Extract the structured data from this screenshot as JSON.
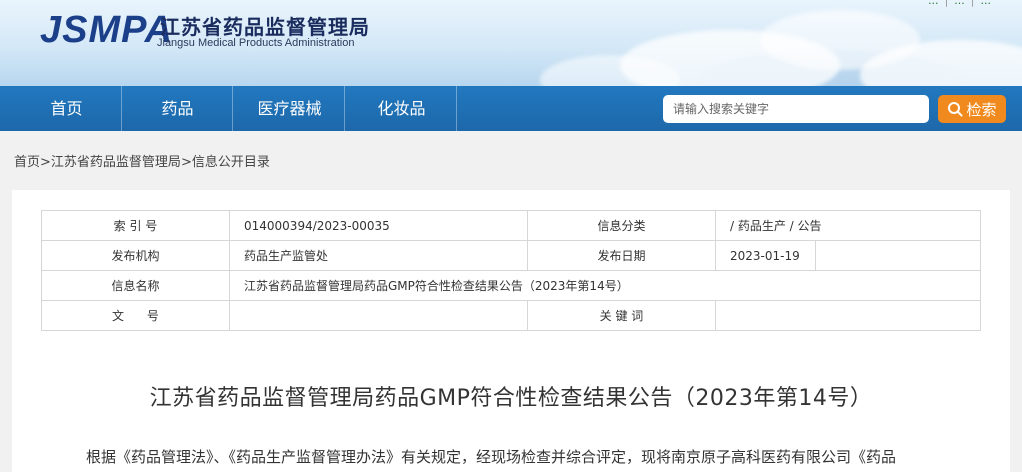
{
  "header": {
    "logo_abbr": "JSMPA",
    "logo_cn": "江苏省药品监督管理局",
    "logo_en": "Jiangsu Medical Products Administration",
    "top_links": [
      "...",
      "...",
      "..."
    ]
  },
  "nav": {
    "items": [
      "首页",
      "药品",
      "医疗器械",
      "化妆品"
    ],
    "search_placeholder": "请输入搜索关键字",
    "search_button": "检索"
  },
  "breadcrumb": {
    "items": [
      "首页",
      "江苏省药品监督管理局",
      "信息公开目录"
    ],
    "separator": ">"
  },
  "info_table": {
    "index_label": "索 引 号",
    "index_value": "014000394/2023-00035",
    "category_label": "信息分类",
    "category_value": "/  药品生产  /  公告",
    "publisher_label": "发布机构",
    "publisher_value": "药品生产监管处",
    "date_label": "发布日期",
    "date_value": "2023-01-19",
    "name_label": "信息名称",
    "name_value": "江苏省药品监督管理局药品GMP符合性检查结果公告（2023年第14号）",
    "docno_label": "文      号",
    "docno_value": "",
    "keywords_label": "关 键 词",
    "keywords_value": ""
  },
  "article": {
    "title": "江苏省药品监督管理局药品GMP符合性检查结果公告（2023年第14号）",
    "body_first_line": "根据《药品管理法》、《药品生产监督管理办法》有关规定，经现场检查并综合评定，现将南京原子高科医药有限公司《药品"
  },
  "colors": {
    "nav_bg": "#1d68aa",
    "search_button": "#f08a1e",
    "logo": "#1c3f8a"
  }
}
